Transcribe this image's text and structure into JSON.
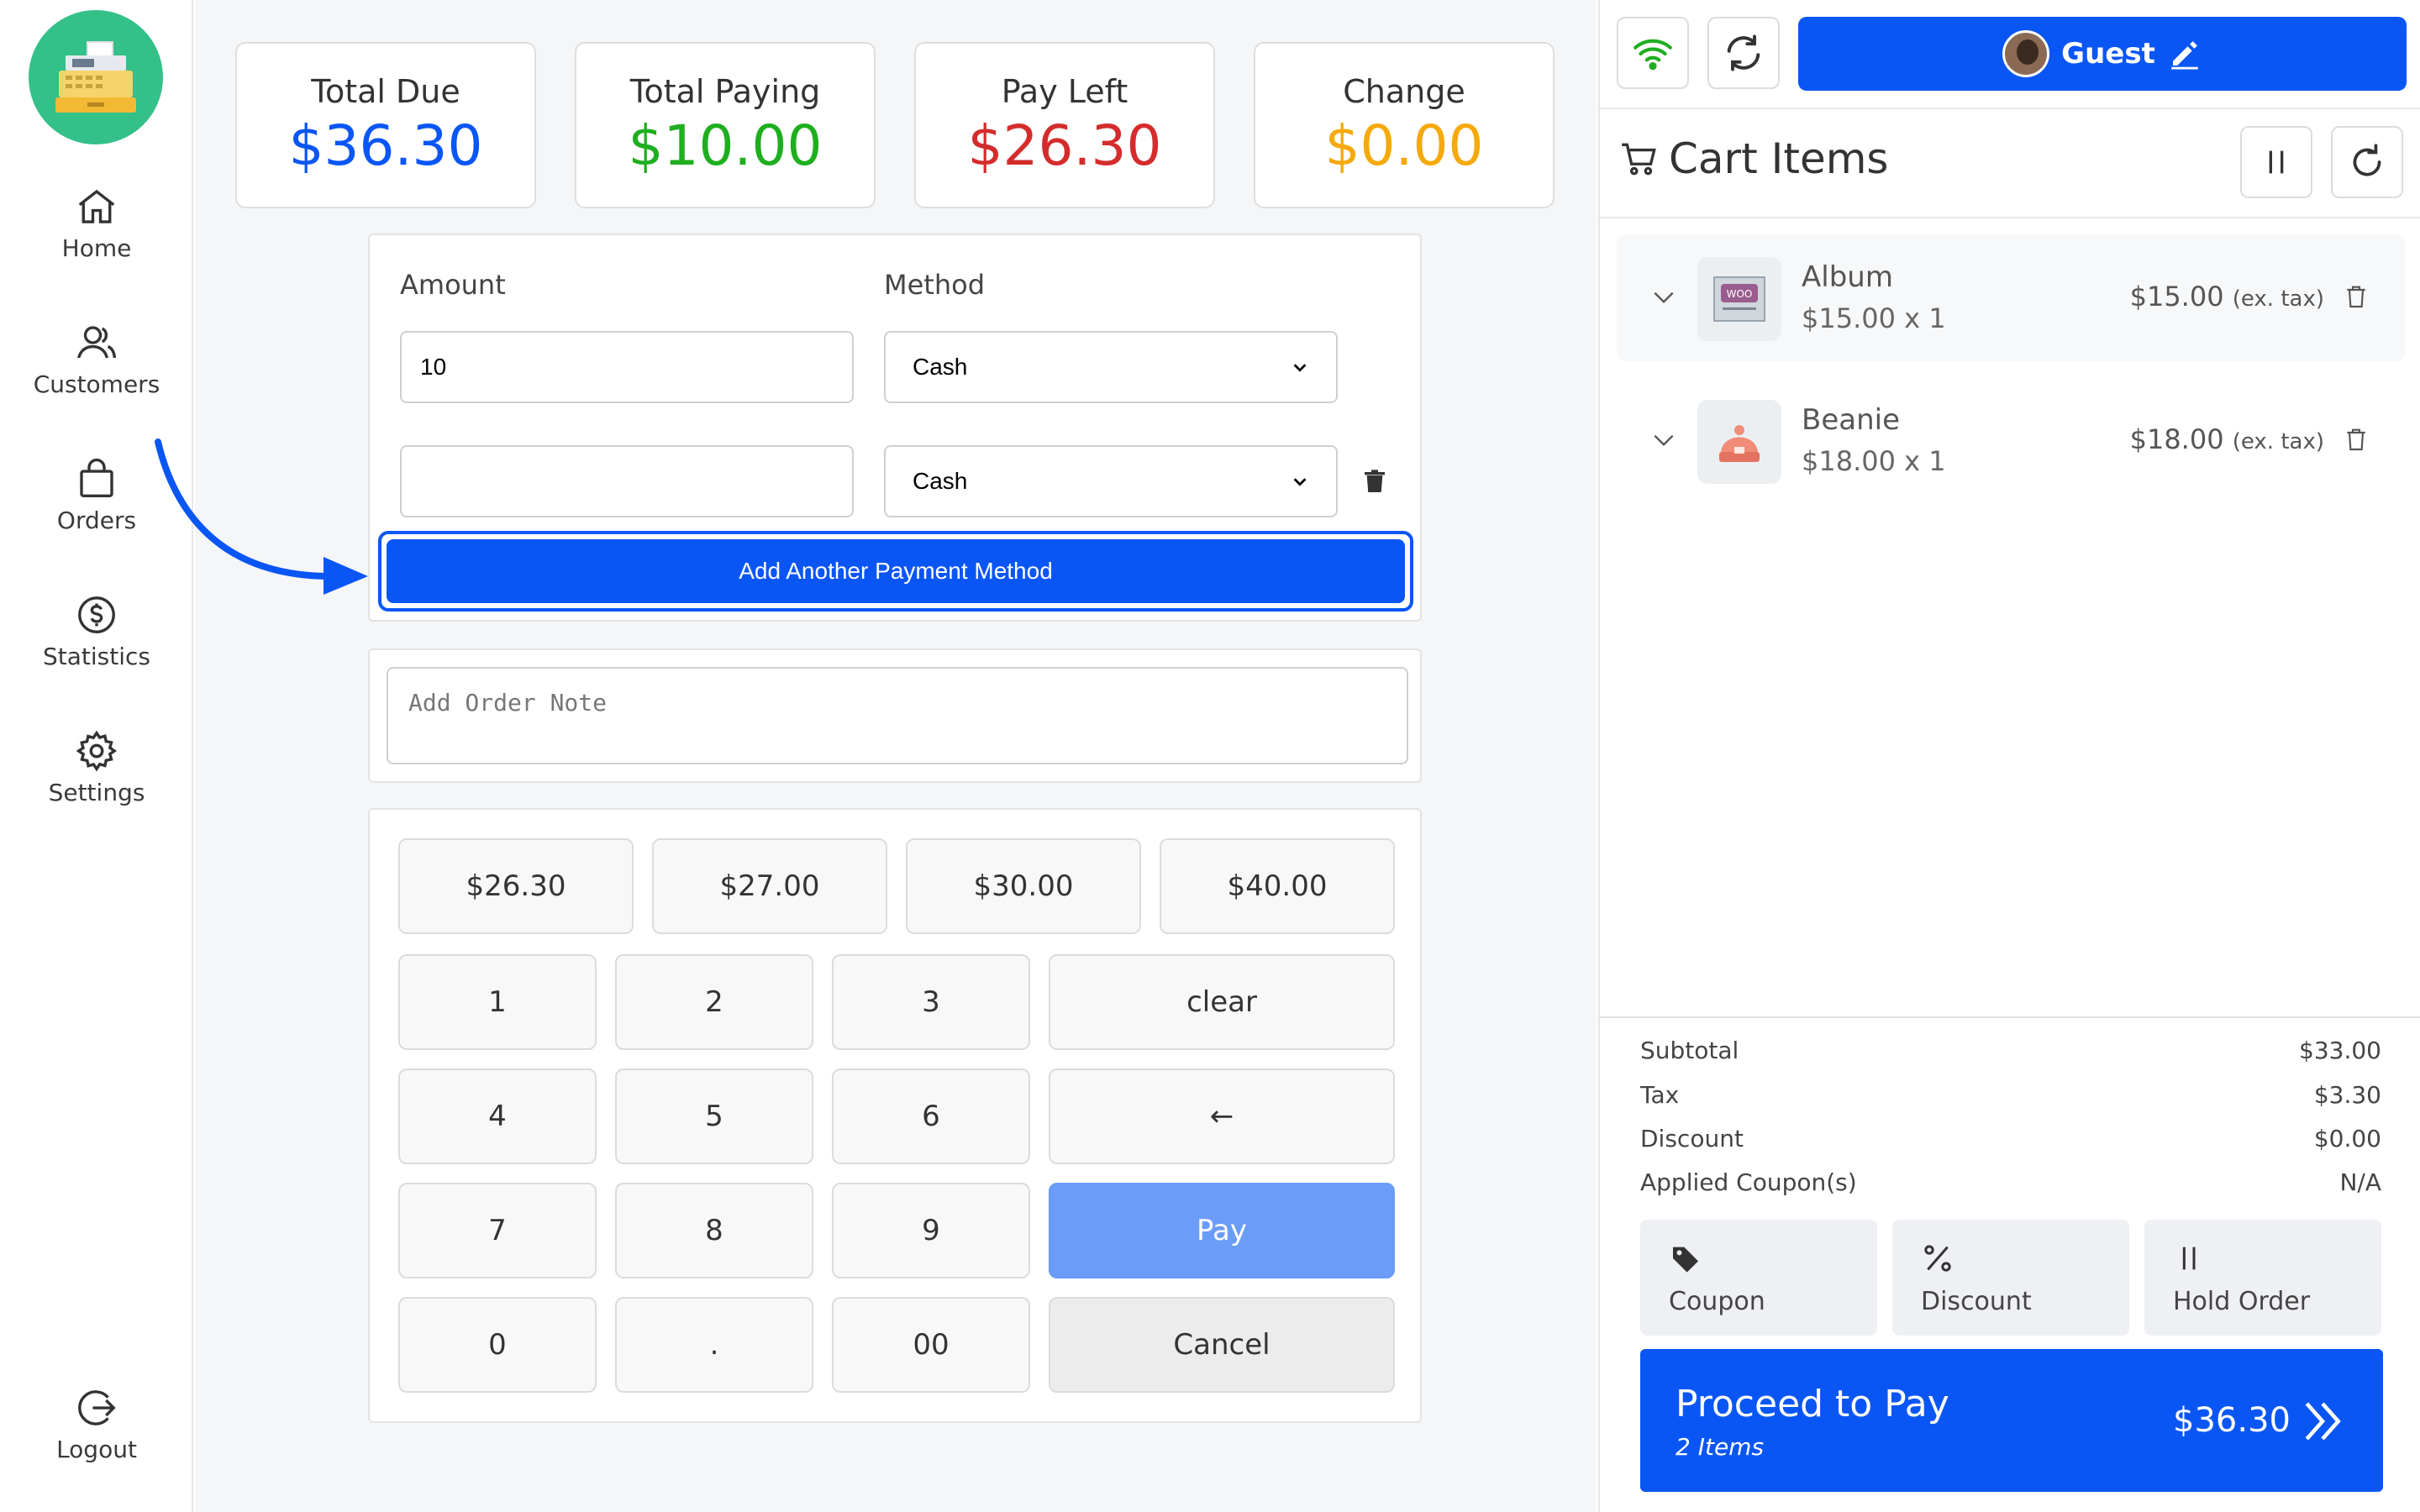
{
  "sidebar": {
    "items": [
      {
        "label": "Home",
        "icon": "home-icon"
      },
      {
        "label": "Customers",
        "icon": "customers-icon"
      },
      {
        "label": "Orders",
        "icon": "orders-icon"
      },
      {
        "label": "Statistics",
        "icon": "statistics-icon"
      },
      {
        "label": "Settings",
        "icon": "gear-icon"
      }
    ],
    "logout": "Logout"
  },
  "stats": [
    {
      "label": "Total Due",
      "value": "$36.30",
      "color": "#0a56f5"
    },
    {
      "label": "Total Paying",
      "value": "$10.00",
      "color": "#1fae1f"
    },
    {
      "label": "Pay Left",
      "value": "$26.30",
      "color": "#d42c2c"
    },
    {
      "label": "Change",
      "value": "$0.00",
      "color": "#f5a90a"
    }
  ],
  "payment": {
    "amount_label": "Amount",
    "method_label": "Method",
    "rows": [
      {
        "amount": "10",
        "method": "Cash"
      },
      {
        "amount": "",
        "method": "Cash"
      }
    ],
    "add_button": "Add Another Payment Method"
  },
  "note": {
    "placeholder": "Add Order Note"
  },
  "keypad": {
    "quick": [
      "$26.30",
      "$27.00",
      "$30.00",
      "$40.00"
    ],
    "keys": [
      "1",
      "2",
      "3",
      "4",
      "5",
      "6",
      "7",
      "8",
      "9",
      "0",
      ".",
      "00"
    ],
    "clear": "clear",
    "backspace": "←",
    "pay": "Pay",
    "cancel": "Cancel"
  },
  "header": {
    "guest": "Guest"
  },
  "cart": {
    "title": "Cart Items",
    "items": [
      {
        "name": "Album",
        "qty": "$15.00 x 1",
        "price": "$15.00",
        "tax_note": "(ex. tax)"
      },
      {
        "name": "Beanie",
        "qty": "$18.00 x 1",
        "price": "$18.00",
        "tax_note": "(ex. tax)"
      }
    ]
  },
  "totals": [
    {
      "label": "Subtotal",
      "value": "$33.00"
    },
    {
      "label": "Tax",
      "value": "$3.30"
    },
    {
      "label": "Discount",
      "value": "$0.00"
    },
    {
      "label": "Applied Coupon(s)",
      "value": "N/A"
    }
  ],
  "actions": {
    "coupon": "Coupon",
    "discount": "Discount",
    "hold": "Hold Order"
  },
  "proceed": {
    "label": "Proceed to Pay",
    "count": "2 Items",
    "amount": "$36.30"
  },
  "colors": {
    "accent": "#0a56f5",
    "logo_bg": "#33c089"
  }
}
